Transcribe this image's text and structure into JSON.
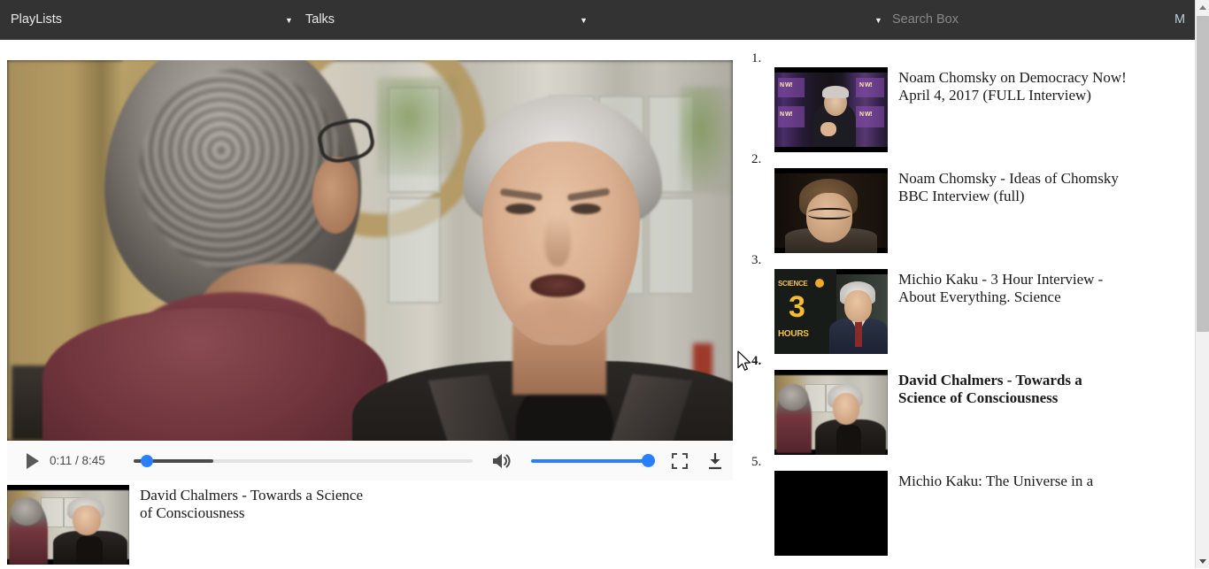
{
  "topbar": {
    "playlists_label": "PlayLists",
    "category_label": "Talks",
    "search_placeholder": "Search Box",
    "search_value": "",
    "user_initial": "M",
    "caret_glyph": "▼",
    "background_color": "#333333"
  },
  "player": {
    "play_label": "▶",
    "time_display": "0:11 / 8:45",
    "current_time": "0:11",
    "duration": "8:45",
    "progress_percent": 2,
    "volume_percent": 100,
    "volume_icon": "volume-on-icon",
    "fullscreen_icon": "fullscreen-icon",
    "download_icon": "download-icon",
    "accent_color": "#2a7fff"
  },
  "now_playing": {
    "title": "David Chalmers - Towards a Science of Consciousness"
  },
  "playlist": {
    "items": [
      {
        "number": "1.",
        "title": "Noam Chomsky on Democracy Now! April 4, 2017 (FULL Interview)",
        "current": false
      },
      {
        "number": "2.",
        "title": "Noam Chomsky - Ideas of Chomsky BBC Interview (full)",
        "current": false
      },
      {
        "number": "3.",
        "title": "Michio Kaku - 3 Hour Interview - About Everything. Science",
        "current": false
      },
      {
        "number": "4.",
        "title": "David Chalmers - Towards a Science of Consciousness",
        "current": true
      },
      {
        "number": "5.",
        "title": "Michio Kaku: The Universe in a",
        "current": false
      }
    ]
  },
  "thumb_text": {
    "kaku_science": "SCIENCE",
    "kaku_three": "3",
    "kaku_hours": "HOURS"
  },
  "scrollbar": {
    "up_arrow": "▲",
    "down_arrow": "▼",
    "thumb_color": "#c1c1c1",
    "track_color": "#f1f1f1"
  }
}
